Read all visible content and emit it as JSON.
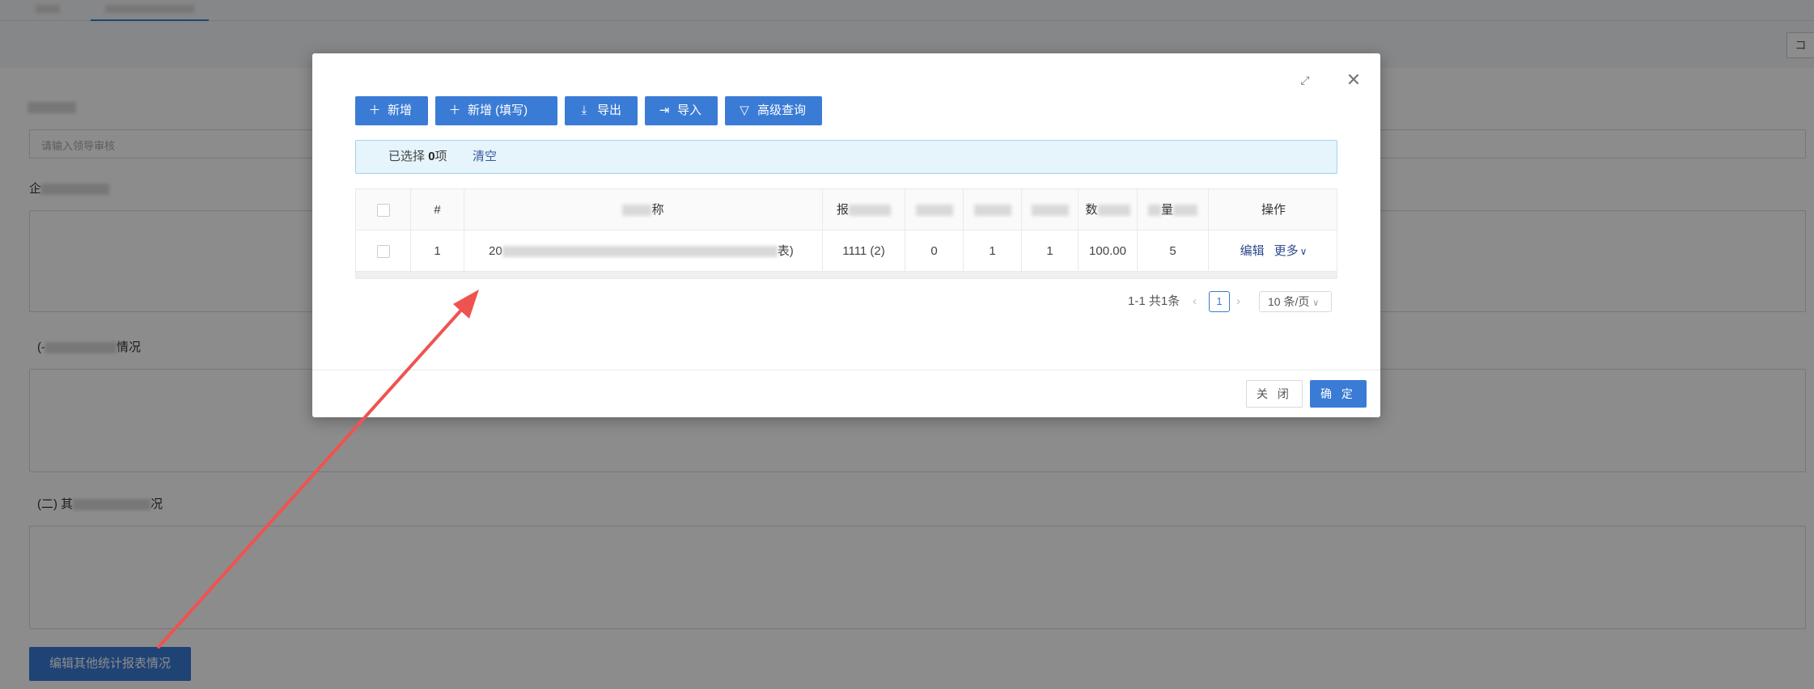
{
  "background": {
    "tabs": [
      "",
      ""
    ],
    "right_edge_label": "コ",
    "field_input_placeholder": "请输入领导审核",
    "section1_label_prefix": "企",
    "section2_label_prefix": "(-",
    "section2_label_suffix": "情况",
    "section3_label_prefix": "(二) 其",
    "section3_label_suffix": "况",
    "edit_button_label": "编辑其他统计报表情况"
  },
  "modal": {
    "toolbar": {
      "add_label": "新增",
      "add_fill_label": "新增 (填写)",
      "export_label": "导出",
      "import_label": "导入",
      "advanced_query_label": "高级查询"
    },
    "selection": {
      "prefix": "已选择",
      "count": "0",
      "suffix": "项",
      "clear_label": "清空"
    },
    "table": {
      "headers": [
        "#",
        "",
        "",
        "",
        "",
        "",
        "",
        "",
        "操作"
      ],
      "header_fragments": {
        "name_tail": "称",
        "col3_head": "报",
        "col7_head": "数",
        "col8_head": "量"
      },
      "rows": [
        {
          "index": "1",
          "name_head": "20",
          "name_tail": "表)",
          "col3": "1111 (2)",
          "col4": "0",
          "col5": "1",
          "col6": "1",
          "col7": "100.00",
          "col8": "5",
          "edit_label": "编辑",
          "more_label": "更多"
        }
      ]
    },
    "pagination": {
      "total_label": "1-1 共1条",
      "current_page": "1",
      "page_size_label": "10 条/页"
    },
    "footer": {
      "close_label": "关 闭",
      "ok_label": "确 定"
    }
  },
  "colors": {
    "primary": "#3a7bd5",
    "alert_bg": "#e6f4fb",
    "arrow": "#ef5350"
  }
}
